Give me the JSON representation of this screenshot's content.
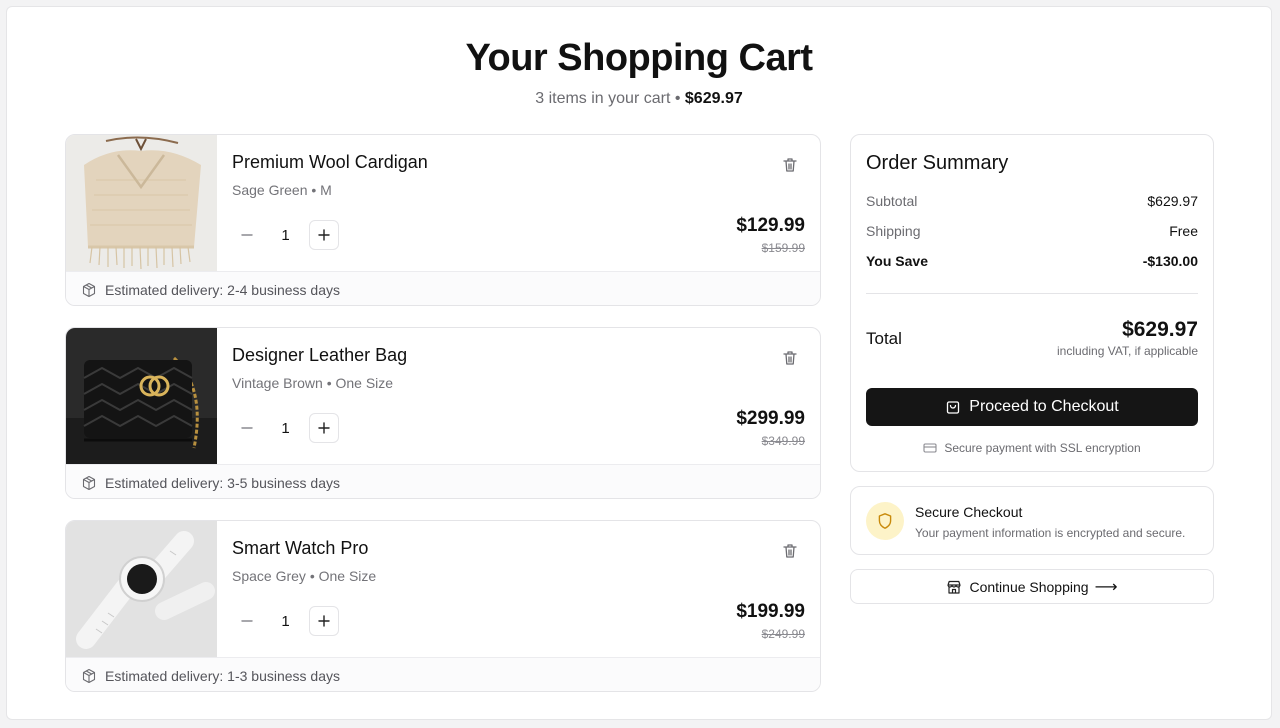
{
  "header": {
    "title": "Your Shopping Cart",
    "subtitle_count": "3 items in your cart",
    "subtitle_sep": "•",
    "subtitle_total": "$629.97"
  },
  "cart": {
    "items": [
      {
        "name": "Premium Wool Cardigan",
        "variant": "Sage Green • M",
        "quantity": "1",
        "price": "$129.99",
        "old_price": "$159.99",
        "delivery": "Estimated delivery: 2-4 business days",
        "image": "knit-cardigan-photo"
      },
      {
        "name": "Designer Leather Bag",
        "variant": "Vintage Brown • One Size",
        "quantity": "1",
        "price": "$299.99",
        "old_price": "$349.99",
        "delivery": "Estimated delivery: 3-5 business days",
        "image": "quilted-leather-bag-photo"
      },
      {
        "name": "Smart Watch Pro",
        "variant": "Space Grey • One Size",
        "quantity": "1",
        "price": "$199.99",
        "old_price": "$249.99",
        "delivery": "Estimated delivery: 1-3 business days",
        "image": "white-smartwatch-photo"
      }
    ]
  },
  "summary": {
    "title": "Order Summary",
    "subtotal_label": "Subtotal",
    "subtotal_value": "$629.97",
    "shipping_label": "Shipping",
    "shipping_value": "Free",
    "save_label": "You Save",
    "save_value": "-$130.00",
    "total_label": "Total",
    "total_value": "$629.97",
    "vat_note": "including VAT, if applicable",
    "checkout_label": "Proceed to Checkout",
    "secure_note": "Secure payment with SSL encryption"
  },
  "secure_box": {
    "title": "Secure Checkout",
    "description": "Your payment information is encrypted and secure."
  },
  "continue": {
    "label": "Continue Shopping",
    "arrow": "⟶"
  },
  "colors": {
    "checkout_bg": "#151515",
    "shield_bg": "#fdf3c8",
    "shield_stroke": "#c98a0b"
  }
}
